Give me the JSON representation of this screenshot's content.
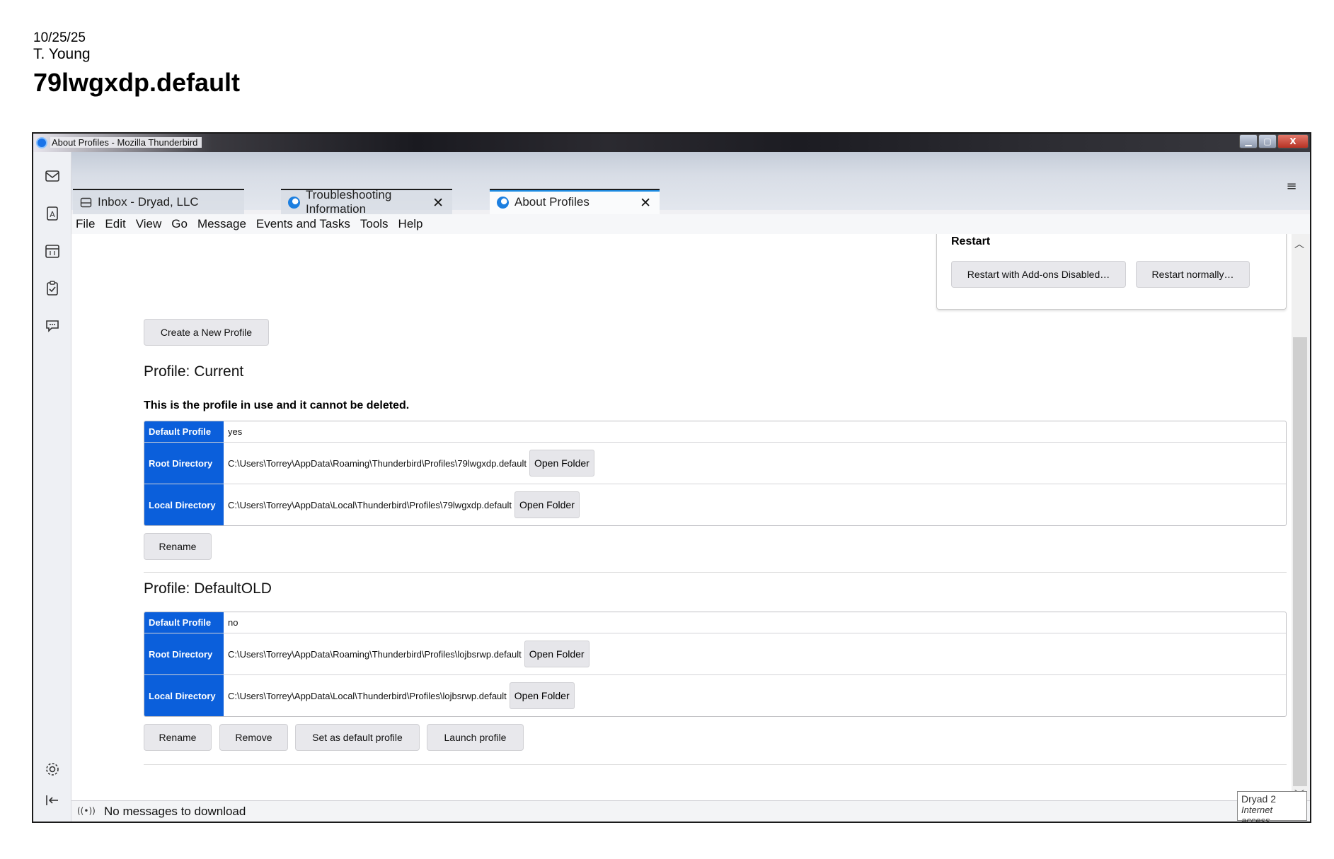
{
  "annotation": {
    "date": "10/25/25",
    "author": "T. Young",
    "title": "79lwgxdp.default"
  },
  "window": {
    "title": "About Profiles - Mozilla Thunderbird",
    "controls": {
      "minimize": "▁",
      "maximize": "▢",
      "close": "X"
    }
  },
  "spaces": [
    "mail-icon",
    "address-book-icon",
    "calendar-icon",
    "tasks-icon",
    "chat-icon",
    "settings-icon",
    "collapse-icon"
  ],
  "tabs": [
    {
      "label": "Inbox - Dryad, LLC",
      "icon": "inbox-icon",
      "active": false
    },
    {
      "label": "Troubleshooting Information",
      "icon": "thunderbird-icon",
      "active": false
    },
    {
      "label": "About Profiles",
      "icon": "thunderbird-icon",
      "active": true
    }
  ],
  "menu": [
    "File",
    "Edit",
    "View",
    "Go",
    "Message",
    "Events and Tasks",
    "Tools",
    "Help"
  ],
  "restart": {
    "title": "Restart",
    "btn_addons_disabled": "Restart with Add-ons Disabled…",
    "btn_normally": "Restart normally…"
  },
  "create_profile_label": "Create a New Profile",
  "profiles": [
    {
      "heading": "Profile: Current",
      "note": "This is the profile in use and it cannot be deleted.",
      "rows": [
        {
          "label": "Default Profile",
          "value": "yes"
        },
        {
          "label": "Root Directory",
          "value": "C:\\Users\\Torrey\\AppData\\Roaming\\Thunderbird\\Profiles\\79lwgxdp.default",
          "button": "Open Folder"
        },
        {
          "label": "Local Directory",
          "value": "C:\\Users\\Torrey\\AppData\\Local\\Thunderbird\\Profiles\\79lwgxdp.default",
          "button": "Open Folder"
        }
      ],
      "actions": [
        "Rename"
      ]
    },
    {
      "heading": "Profile: DefaultOLD",
      "rows": [
        {
          "label": "Default Profile",
          "value": "no"
        },
        {
          "label": "Root Directory",
          "value": "C:\\Users\\Torrey\\AppData\\Roaming\\Thunderbird\\Profiles\\lojbsrwp.default",
          "button": "Open Folder"
        },
        {
          "label": "Local Directory",
          "value": "C:\\Users\\Torrey\\AppData\\Local\\Thunderbird\\Profiles\\lojbsrwp.default",
          "button": "Open Folder"
        }
      ],
      "actions": [
        "Rename",
        "Remove",
        "Set as default profile",
        "Launch profile"
      ]
    }
  ],
  "status": {
    "text": "No messages to download",
    "tooltip_line1": "Dryad  2",
    "tooltip_line2": "Internet access"
  },
  "colors": {
    "label_blue": "#0b5fdb",
    "accent": "#1e8ee6"
  }
}
